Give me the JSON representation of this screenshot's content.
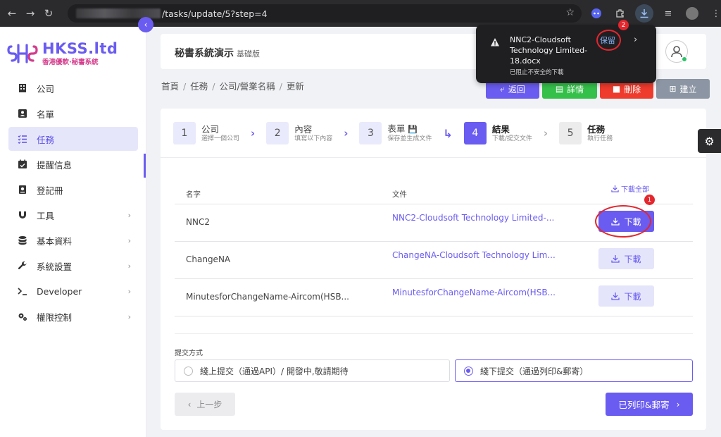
{
  "browser": {
    "url": "/tasks/update/5?step=4"
  },
  "sidebar": {
    "logo_title": "HKSS.ltd",
    "logo_subtitle": "香港優軟·秘書系統",
    "items": [
      {
        "label": "公司",
        "icon": "building-icon"
      },
      {
        "label": "名單",
        "icon": "contact-card-icon"
      },
      {
        "label": "任務",
        "icon": "task-list-icon",
        "active": true
      },
      {
        "label": "提醒信息",
        "icon": "calendar-check-icon"
      },
      {
        "label": "登記冊",
        "icon": "register-book-icon"
      },
      {
        "label": "工具",
        "icon": "magnet-icon",
        "expandable": true
      },
      {
        "label": "基本資料",
        "icon": "database-icon",
        "expandable": true
      },
      {
        "label": "系統設置",
        "icon": "wrench-icon",
        "expandable": true
      },
      {
        "label": "Developer",
        "icon": "terminal-icon",
        "expandable": true
      },
      {
        "label": "權限控制",
        "icon": "gears-icon",
        "expandable": true
      }
    ]
  },
  "header": {
    "title": "秘書系統演示",
    "subtitle": "基礎版"
  },
  "breadcrumb": [
    "首頁",
    "任務",
    "公司/營業名稱",
    "更新"
  ],
  "actions": {
    "back": "返回",
    "detail": "詳情",
    "delete": "刪除",
    "create": "建立"
  },
  "steps": [
    {
      "num": "1",
      "title": "公司",
      "desc": "選擇一個公司"
    },
    {
      "num": "2",
      "title": "內容",
      "desc": "填寫以下內容"
    },
    {
      "num": "3",
      "title": "表單",
      "desc": "保存並生成文件"
    },
    {
      "num": "4",
      "title": "結果",
      "desc": "下載/提交文件",
      "active": true
    },
    {
      "num": "5",
      "title": "任務",
      "desc": "執行任務"
    }
  ],
  "table": {
    "col_name": "名字",
    "col_file": "文件",
    "download_all": "下載全部",
    "download_label": "下載",
    "rows": [
      {
        "name": "NNC2",
        "file": "NNC2-Cloudsoft Technology Limited-..."
      },
      {
        "name": "ChangeNA",
        "file": "ChangeNA-Cloudsoft Technology Lim..."
      },
      {
        "name": "MinutesforChangeName-Aircom(HSB...",
        "file": "MinutesforChangeName-Aircom(HSB..."
      }
    ]
  },
  "submit": {
    "label": "提交方式",
    "online": "綫上提交（通過API）/ 開發中,敬請期待",
    "offline": "綫下提交（通過列印&郵寄）",
    "selected": "offline"
  },
  "nav": {
    "prev": "上一步",
    "next": "已列印&郵寄"
  },
  "download_popup": {
    "filename": "NNC2-Cloudsoft Technology Limited-18.docx",
    "keep": "保留",
    "warning": "已阻止不安全的下載"
  },
  "annotations": {
    "badge1": "1",
    "badge2": "2"
  },
  "colors": {
    "accent": "#6a5cf0",
    "success": "#35c04a",
    "danger": "#ef3b2d",
    "neutral": "#8b95a3",
    "annotation": "#e4262d"
  }
}
